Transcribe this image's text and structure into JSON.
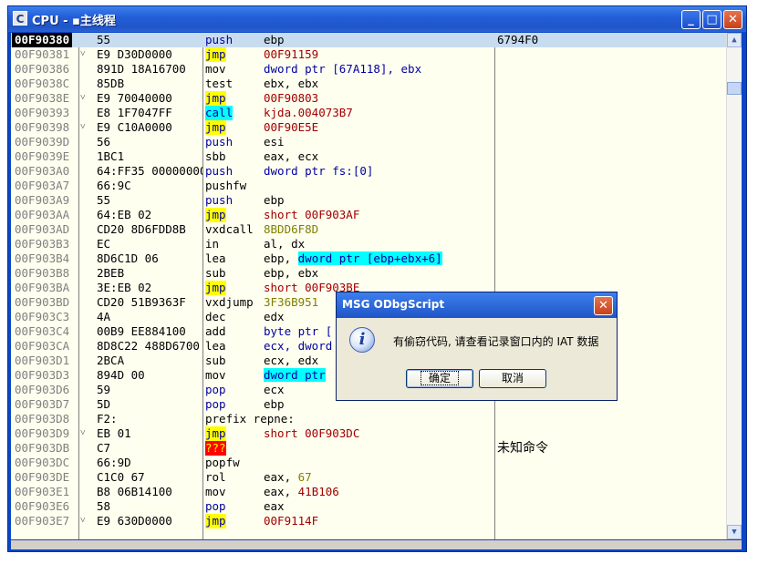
{
  "window": {
    "icon_letter": "C",
    "title": "CPU - ▪主线程",
    "minimize_glyph": "_",
    "maximize_glyph": "□",
    "close_glyph": "✕"
  },
  "disasm": {
    "rows": [
      {
        "addr": "00F90380",
        "arrow": "",
        "hex": "55",
        "mnem": "push",
        "ops": "ebp",
        "cmt": "6794F0"
      },
      {
        "addr": "00F90381",
        "arrow": "˅",
        "hex": "E9 D30D0000",
        "mnem": "jmp",
        "ops": "00F91159",
        "cmt": ""
      },
      {
        "addr": "00F90386",
        "arrow": "",
        "hex": "891D 18A16700",
        "mnem": "mov",
        "ops": "dword ptr [67A118], ebx",
        "cmt": ""
      },
      {
        "addr": "00F9038C",
        "arrow": "",
        "hex": "85DB",
        "mnem": "test",
        "ops": "ebx, ebx",
        "cmt": ""
      },
      {
        "addr": "00F9038E",
        "arrow": "˅",
        "hex": "E9 70040000",
        "mnem": "jmp",
        "ops": "00F90803",
        "cmt": ""
      },
      {
        "addr": "00F90393",
        "arrow": "",
        "hex": "E8 1F7047FF",
        "mnem": "call",
        "ops": "kjda.004073B7",
        "cmt": ""
      },
      {
        "addr": "00F90398",
        "arrow": "˅",
        "hex": "E9 C10A0000",
        "mnem": "jmp",
        "ops": "00F90E5E",
        "cmt": ""
      },
      {
        "addr": "00F9039D",
        "arrow": "",
        "hex": "56",
        "mnem": "push",
        "ops": "esi",
        "cmt": ""
      },
      {
        "addr": "00F9039E",
        "arrow": "",
        "hex": "1BC1",
        "mnem": "sbb",
        "ops": "eax, ecx",
        "cmt": ""
      },
      {
        "addr": "00F903A0",
        "arrow": "",
        "hex": "64:FF35 00000000",
        "mnem": "push",
        "ops": "dword ptr fs:[0]",
        "cmt": ""
      },
      {
        "addr": "00F903A7",
        "arrow": "",
        "hex": "66:9C",
        "mnem": "pushfw",
        "ops": "",
        "cmt": ""
      },
      {
        "addr": "00F903A9",
        "arrow": "",
        "hex": "55",
        "mnem": "push",
        "ops": "ebp",
        "cmt": ""
      },
      {
        "addr": "00F903AA",
        "arrow": "",
        "hex": "64:EB 02",
        "mnem": "jmp",
        "ops": "short 00F903AF",
        "cmt": ""
      },
      {
        "addr": "00F903AD",
        "arrow": "",
        "hex": "CD20 8D6FDD8B",
        "mnem": "vxdcall",
        "ops": "8BDD6F8D",
        "cmt": ""
      },
      {
        "addr": "00F903B3",
        "arrow": "",
        "hex": "EC",
        "mnem": "in",
        "ops": "al, dx",
        "cmt": ""
      },
      {
        "addr": "00F903B4",
        "arrow": "",
        "hex": "8D6C1D 06",
        "mnem": "lea",
        "ops_pre": "ebp, ",
        "ops": "dword ptr [ebp+ebx+6]",
        "cmt": ""
      },
      {
        "addr": "00F903B8",
        "arrow": "",
        "hex": "2BEB",
        "mnem": "sub",
        "ops": "ebp, ebx",
        "cmt": ""
      },
      {
        "addr": "00F903BA",
        "arrow": "",
        "hex": "3E:EB 02",
        "mnem": "jmp",
        "ops": "short 00F903BE",
        "cmt": ""
      },
      {
        "addr": "00F903BD",
        "arrow": "",
        "hex": "CD20 51B9363F",
        "mnem": "vxdjump",
        "ops": "3F36B951",
        "cmt": ""
      },
      {
        "addr": "00F903C3",
        "arrow": "",
        "hex": "4A",
        "mnem": "dec",
        "ops": "edx",
        "cmt": ""
      },
      {
        "addr": "00F903C4",
        "arrow": "",
        "hex": "00B9 EE884100",
        "mnem": "add",
        "ops": "byte ptr [",
        "cmt": ""
      },
      {
        "addr": "00F903CA",
        "arrow": "",
        "hex": "8D8C22 488D6700",
        "mnem": "lea",
        "ops": "ecx, dword",
        "cmt": ""
      },
      {
        "addr": "00F903D1",
        "arrow": "",
        "hex": "2BCA",
        "mnem": "sub",
        "ops": "ecx, edx",
        "cmt": ""
      },
      {
        "addr": "00F903D3",
        "arrow": "",
        "hex": "894D 00",
        "mnem": "mov",
        "ops": "dword ptr",
        "cmt": ""
      },
      {
        "addr": "00F903D6",
        "arrow": "",
        "hex": "59",
        "mnem": "pop",
        "ops": "ecx",
        "cmt": ""
      },
      {
        "addr": "00F903D7",
        "arrow": "",
        "hex": "5D",
        "mnem": "pop",
        "ops": "ebp",
        "cmt": ""
      },
      {
        "addr": "00F903D8",
        "arrow": "",
        "hex": "F2:",
        "mnem": "prefix repne:",
        "ops": "",
        "cmt": ""
      },
      {
        "addr": "00F903D9",
        "arrow": "˅",
        "hex": "EB 01",
        "mnem": "jmp",
        "ops": "short 00F903DC",
        "cmt": ""
      },
      {
        "addr": "00F903DB",
        "arrow": "",
        "hex": "C7",
        "mnem": "???",
        "ops": "",
        "cmt": "未知命令"
      },
      {
        "addr": "00F903DC",
        "arrow": "",
        "hex": "66:9D",
        "mnem": "popfw",
        "ops": "",
        "cmt": ""
      },
      {
        "addr": "00F903DE",
        "arrow": "",
        "hex": "C1C0 67",
        "mnem": "rol",
        "ops_pre": "eax, ",
        "ops": "67",
        "cmt": ""
      },
      {
        "addr": "00F903E1",
        "arrow": "",
        "hex": "B8 06B14100",
        "mnem": "mov",
        "ops_pre": "eax, ",
        "ops": "41B106",
        "cmt": ""
      },
      {
        "addr": "00F903E6",
        "arrow": "",
        "hex": "58",
        "mnem": "pop",
        "ops": "eax",
        "cmt": ""
      },
      {
        "addr": "00F903E7",
        "arrow": "˅",
        "hex": "E9 630D0000",
        "mnem": "jmp",
        "ops": "00F9114F",
        "cmt": ""
      }
    ]
  },
  "dialog": {
    "title": "MSG ODbgScript",
    "close_glyph": "✕",
    "icon_glyph": "i",
    "message": "有偷窃代码, 请查看记录窗口内的 IAT 数据",
    "ok_label": "确定",
    "cancel_label": "取消"
  },
  "scrollbar": {
    "up_glyph": "▲",
    "down_glyph": "▼"
  },
  "colors": {
    "jump_highlight": "#ffff00",
    "call_highlight": "#00ffff",
    "unknown_highlight": "#ff0000",
    "window_frame": "#0b46c8"
  }
}
